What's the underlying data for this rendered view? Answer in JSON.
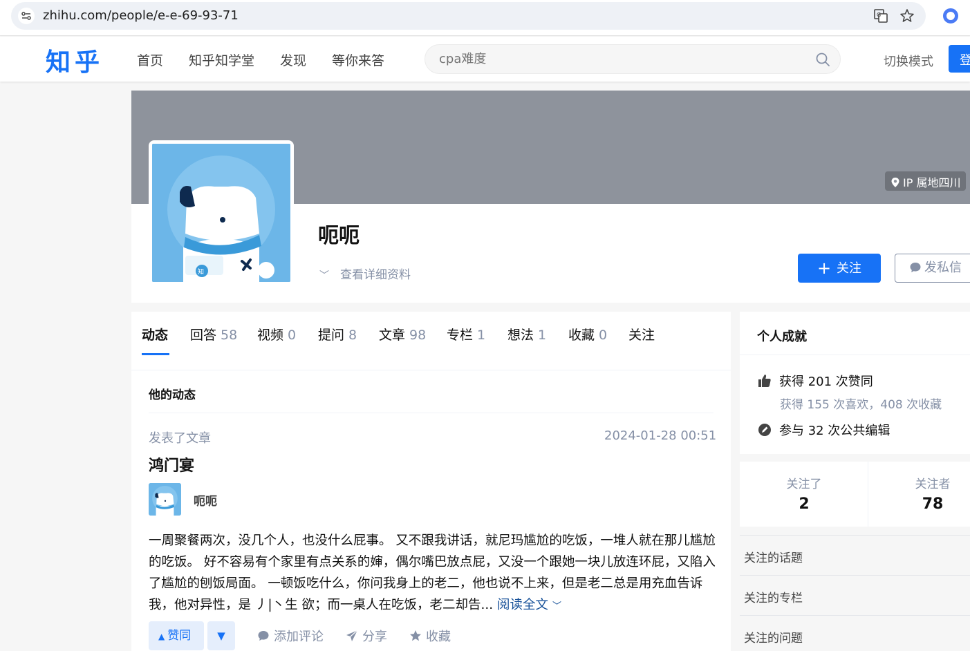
{
  "browser": {
    "url": "zhihu.com/people/e-e-69-93-71"
  },
  "header": {
    "logo": "知乎",
    "nav": [
      "首页",
      "知乎知学堂",
      "发现",
      "等你来答"
    ],
    "search_placeholder": "cpa难度",
    "switch_mode": "切换模式",
    "login": "登"
  },
  "profile": {
    "ip_location": "IP 属地四川",
    "name": "呃呃",
    "detail_link": "查看详细资料",
    "follow_button": "关注",
    "message_button": "发私信"
  },
  "tabs": [
    {
      "label": "动态",
      "count": ""
    },
    {
      "label": "回答",
      "count": "58"
    },
    {
      "label": "视频",
      "count": "0"
    },
    {
      "label": "提问",
      "count": "8"
    },
    {
      "label": "文章",
      "count": "98"
    },
    {
      "label": "专栏",
      "count": "1"
    },
    {
      "label": "想法",
      "count": "1"
    },
    {
      "label": "收藏",
      "count": "0"
    },
    {
      "label": "关注",
      "count": ""
    }
  ],
  "activity": {
    "section_title": "他的动态",
    "type": "发表了文章",
    "time": "2024-01-28 00:51",
    "title": "鸿门宴",
    "author": "呃呃",
    "excerpt": "一周聚餐两次，没几个人，也没什么屁事。 又不跟我讲话，就尼玛尴尬的吃饭，一堆人就在那儿尴尬的吃饭。 好不容易有个家里有点关系的婶，偶尔嘴巴放点屁，又没一个跟她一块儿放连环屁，又陷入了尴尬的刨饭局面。 一顿饭吃什么，你问我身上的老二，他也说不上来，但是老二总是用充血告诉我，他对异性，是 丿|丶生 欲；而一桌人在吃饭，老二却告...",
    "read_more": "阅读全文",
    "vote_up": "赞同",
    "comment": "添加评论",
    "share": "分享",
    "collect": "收藏"
  },
  "sidebar": {
    "achievements_title": "个人成就",
    "likes": "获得 201 次赞同",
    "likes_sub": "获得 155 次喜欢，408 次收藏",
    "edits": "参与 32 次公共编辑",
    "following_label": "关注了",
    "following_count": "2",
    "followers_label": "关注者",
    "followers_count": "78",
    "links": [
      "关注的话题",
      "关注的专栏",
      "关注的问题"
    ]
  },
  "colors": {
    "brand": "#1772f6",
    "cover": "#8e939c",
    "avatar_bg": "#6cb6e8"
  }
}
